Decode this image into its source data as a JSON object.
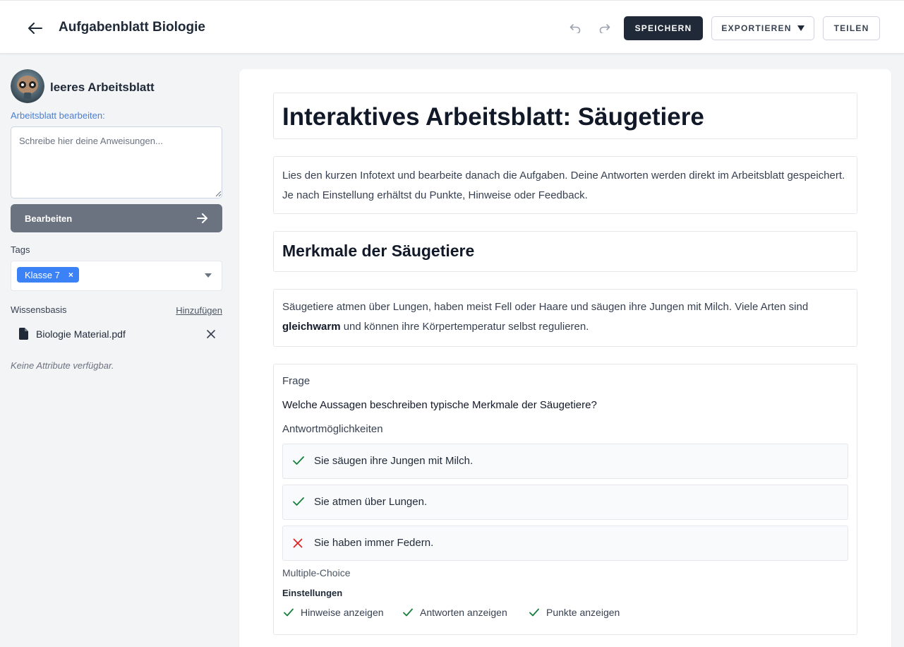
{
  "header": {
    "title": "Aufgabenblatt Biologie",
    "save_label": "SPEICHERN",
    "export_label": "EXPORTIEREN",
    "share_label": "TEILEN"
  },
  "sidebar": {
    "worksheet_name": "leeres Arbeitsblatt",
    "edit_label": "Arbeitsblatt bearbeiten:",
    "instructions_placeholder": "Schreibe hier deine Anweisungen...",
    "edit_button": "Bearbeiten",
    "tags_label": "Tags",
    "tags": [
      "Klasse 7"
    ],
    "knowledge_base_label": "Wissensbasis",
    "add_label": "Hinzufügen",
    "files": [
      "Biologie Material.pdf"
    ],
    "no_attributes": "Keine Attribute verfügbar."
  },
  "worksheet": {
    "title": "Interaktives Arbeitsblatt: Säugetiere",
    "intro": "Lies den kurzen Infotext und bearbeite danach die Aufgaben. Deine Antworten werden direkt im Arbeitsblatt gespeichert. Je nach Einstellung erhältst du Punkte, Hinweise oder Feedback.",
    "section_heading": "Merkmale der Säugetiere",
    "info_text_before": "Säugetiere atmen über Lungen, haben meist Fell oder Haare und säugen ihre Jungen mit Milch. Viele Arten sind ",
    "info_text_bold": "gleichwarm",
    "info_text_after": " und können ihre Körpertemperatur selbst regulieren.",
    "question": {
      "label": "Frage",
      "text": "Welche Aussagen beschreiben typische Merkmale der Säugetiere?",
      "options_label": "Antwortmöglichkeiten",
      "options": [
        {
          "text": "Sie säugen ihre Jungen mit Milch.",
          "correct": true
        },
        {
          "text": "Sie atmen über Lungen.",
          "correct": true
        },
        {
          "text": "Sie haben immer Federn.",
          "correct": false
        }
      ],
      "type_label": "Multiple-Choice",
      "settings_label": "Einstellungen",
      "settings": [
        "Hinweise anzeigen",
        "Antworten anzeigen",
        "Punkte anzeigen"
      ]
    }
  },
  "colors": {
    "primary_dark": "#1f2937",
    "accent_blue": "#3b82f6",
    "link_blue": "#4a7fd1",
    "correct_green": "#15803d",
    "wrong_red": "#dc2626"
  }
}
